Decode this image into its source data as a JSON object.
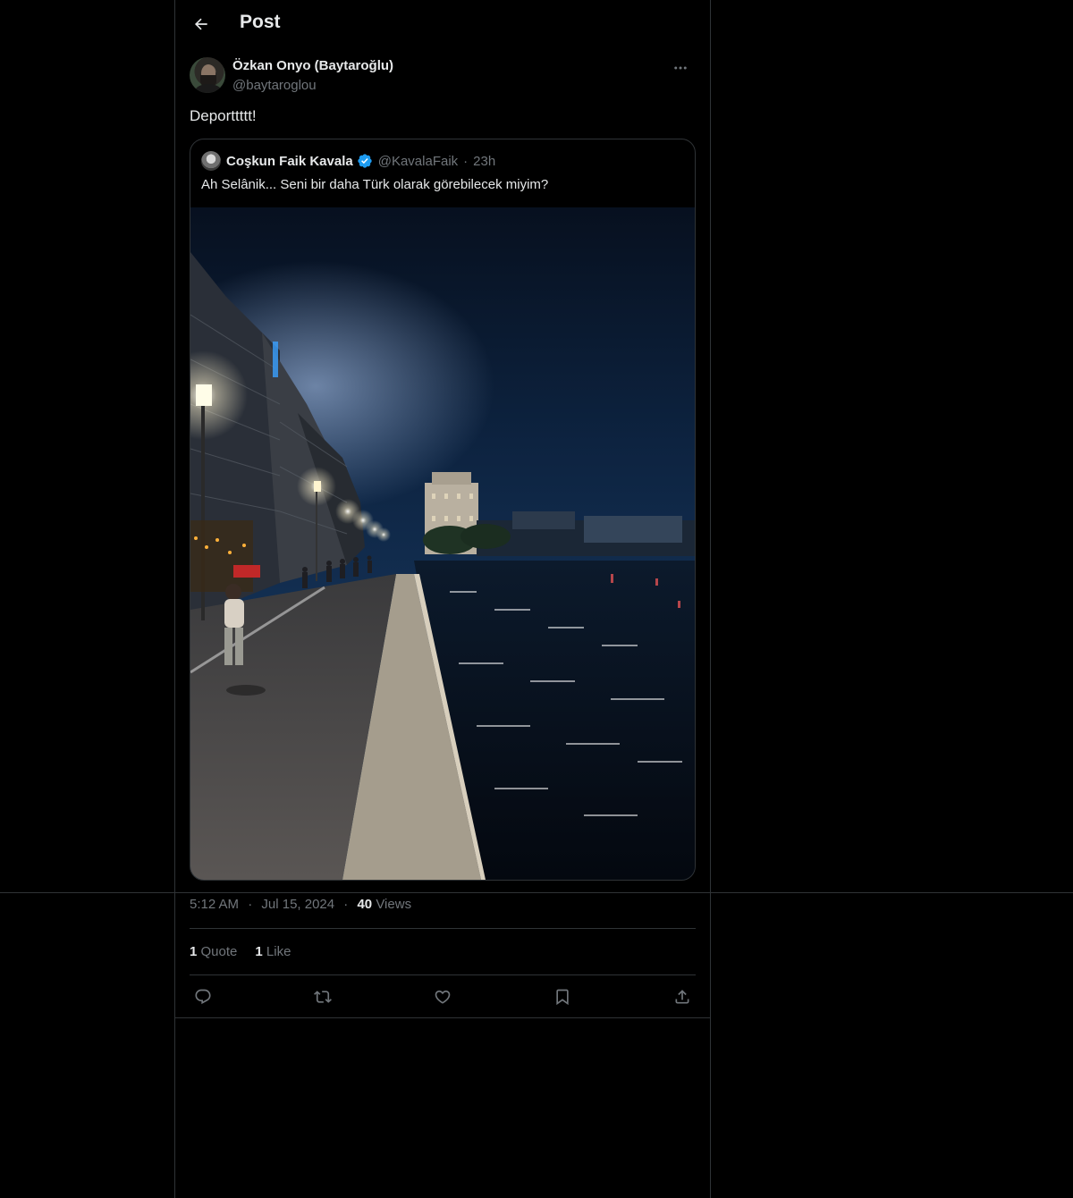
{
  "header": {
    "title": "Post",
    "back_icon": "arrow-left-icon"
  },
  "post": {
    "author": {
      "name": "Özkan Onyo (Baytaroğlu)",
      "handle": "@baytaroglou"
    },
    "more_icon": "more-horizontal-icon",
    "text": "Deporttttt!",
    "quote": {
      "author_name": "Coşkun Faik Kavala",
      "verified": true,
      "handle": "@KavalaFaik",
      "separator": "·",
      "time": "23h",
      "text": "Ah Selânik... Seni bir daha Türk olarak görebilecek miyim?",
      "media_description_icon": "night-waterfront-photo"
    },
    "meta": {
      "time": "5:12 AM",
      "dot1": "·",
      "date": "Jul 15, 2024",
      "dot2": "·",
      "views_count": "40",
      "views_label": "Views"
    },
    "stats": {
      "quote_count": "1",
      "quote_label": "Quote",
      "like_count": "1",
      "like_label": "Like"
    },
    "actions": [
      "reply-icon",
      "repost-icon",
      "like-icon",
      "bookmark-icon",
      "share-icon"
    ]
  },
  "colors": {
    "background": "#000000",
    "text_primary": "#e7e9ea",
    "text_secondary": "#71767b",
    "border": "#2f3336",
    "verified": "#1d9bf0"
  }
}
